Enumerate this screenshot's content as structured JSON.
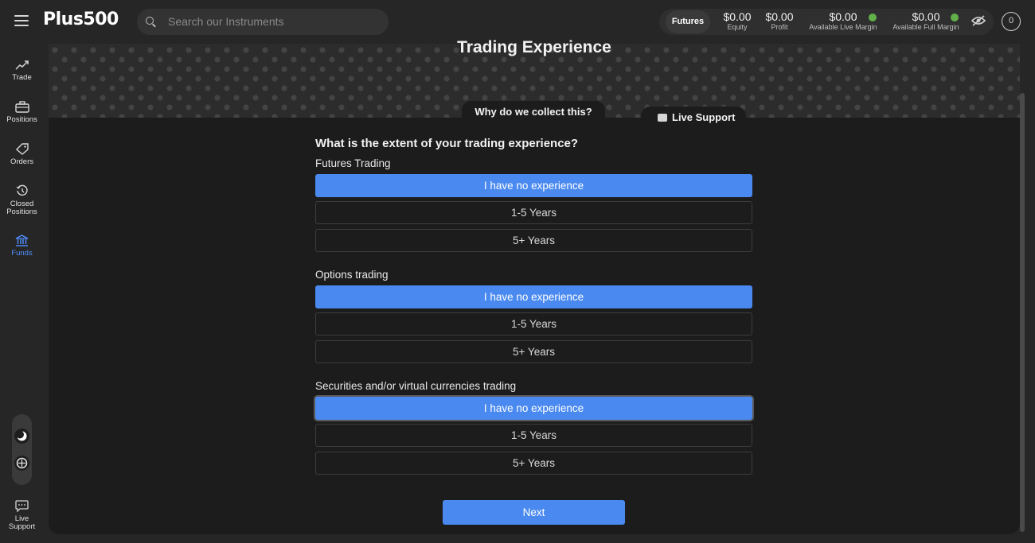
{
  "header": {
    "logo_text": "Plus500",
    "search_placeholder": "Search our Instruments",
    "futures_label": "Futures",
    "stats": [
      {
        "value": "$0.00",
        "label": "Equity"
      },
      {
        "value": "$0.00",
        "label": "Profit"
      },
      {
        "value": "$0.00",
        "label": "Available Live Margin"
      },
      {
        "value": "$0.00",
        "label": "Available Full Margin"
      }
    ],
    "profile_initial": "0"
  },
  "sidebar": {
    "items": [
      {
        "label": "Trade",
        "icon": "trend-up-icon"
      },
      {
        "label": "Positions",
        "icon": "briefcase-icon"
      },
      {
        "label": "Orders",
        "icon": "tag-icon"
      },
      {
        "label_line1": "Closed",
        "label_line2": "Positions",
        "icon": "history-icon"
      },
      {
        "label": "Funds",
        "icon": "bank-icon",
        "active": true
      },
      {
        "label_line1": "Live",
        "label_line2": "Support",
        "icon": "chat-icon"
      }
    ]
  },
  "main": {
    "title": "Trading Experience",
    "why_tab": "Why do we collect this?",
    "live_support": "Live Support",
    "question": "What is the extent of your trading experience?",
    "groups": [
      {
        "label": "Futures Trading",
        "options": [
          "I have no experience",
          "1-5 Years",
          "5+ Years"
        ],
        "selected": 0
      },
      {
        "label": "Options trading",
        "options": [
          "I have no experience",
          "1-5 Years",
          "5+ Years"
        ],
        "selected": 0
      },
      {
        "label": "Securities and/or virtual currencies trading",
        "options": [
          "I have no experience",
          "1-5 Years",
          "5+ Years"
        ],
        "selected": 0
      }
    ],
    "next_label": "Next"
  },
  "colors": {
    "accent": "#4a8af0",
    "background": "#262626",
    "panel": "#1c1c1c",
    "status_green": "#62b04a"
  }
}
